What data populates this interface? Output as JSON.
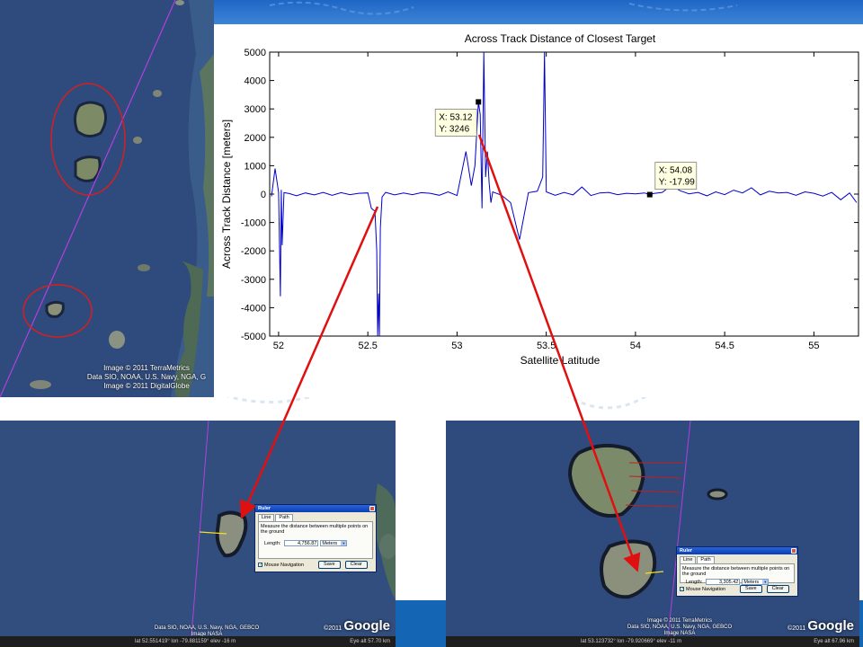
{
  "chart_data": {
    "type": "line",
    "title": "Across Track Distance of Closest Target",
    "xlabel": "Satellite Latitude",
    "ylabel": "Across Track Distance [meters]",
    "xlim": [
      51.95,
      55.25
    ],
    "ylim": [
      -5000,
      5000
    ],
    "x_ticks": [
      52,
      52.5,
      53,
      53.5,
      54,
      54.5,
      55
    ],
    "x_tick_labels": [
      "52",
      "52.5",
      "53",
      "53.5",
      "54",
      "54.5",
      "55"
    ],
    "y_ticks": [
      -5000,
      -4000,
      -3000,
      -2000,
      -1000,
      0,
      1000,
      2000,
      3000,
      4000,
      5000
    ],
    "y_tick_labels": [
      "-5000",
      "-4000",
      "-3000",
      "-2000",
      "-1000",
      "0",
      "1000",
      "2000",
      "3000",
      "4000",
      "5000"
    ],
    "grid": false,
    "line_color": "#0000cc",
    "series": [
      {
        "x": [
          51.96,
          51.98,
          52.0,
          52.01,
          52.015,
          52.02,
          52.03,
          52.06,
          52.1,
          52.15,
          52.2,
          52.25,
          52.3,
          52.35,
          52.4,
          52.45,
          52.5,
          52.52,
          52.54,
          52.55,
          52.555,
          52.56,
          52.565,
          52.57,
          52.58,
          52.6,
          52.65,
          52.7,
          52.75,
          52.8,
          52.85,
          52.9,
          52.95,
          53.0,
          53.05,
          53.08,
          53.1,
          53.12,
          53.13,
          53.14,
          53.15,
          53.16,
          53.17,
          53.18,
          53.19,
          53.2,
          53.25,
          53.3,
          53.35,
          53.4,
          53.45,
          53.48,
          53.49,
          53.5,
          53.55,
          53.6,
          53.65,
          53.7,
          53.75,
          53.8,
          53.85,
          53.9,
          53.95,
          54.0,
          54.05,
          54.08,
          54.1,
          54.15,
          54.2,
          54.25,
          54.3,
          54.35,
          54.4,
          54.45,
          54.5,
          54.55,
          54.6,
          54.65,
          54.7,
          54.75,
          54.8,
          54.85,
          54.9,
          54.95,
          55.0,
          55.05,
          55.1,
          55.15,
          55.2,
          55.24
        ],
        "y": [
          -80,
          900,
          60,
          -3600,
          150,
          -1800,
          50,
          20,
          -60,
          40,
          -30,
          60,
          -40,
          50,
          -20,
          30,
          40,
          -500,
          -600,
          -2000,
          -5000,
          -3500,
          -5000,
          -1200,
          -100,
          60,
          -30,
          40,
          -20,
          50,
          30,
          -40,
          80,
          -50,
          1500,
          300,
          1000,
          3246,
          2800,
          -500,
          5000,
          600,
          1500,
          400,
          -300,
          80,
          -40,
          -300,
          -1600,
          50,
          100,
          600,
          5000,
          80,
          -40,
          60,
          -30,
          250,
          -50,
          40,
          60,
          -20,
          30,
          10,
          40,
          -17.99,
          20,
          60,
          300,
          120,
          10,
          60,
          -60,
          80,
          -20,
          140,
          40,
          220,
          -30,
          100,
          40,
          60,
          -40,
          80,
          30,
          -70,
          60,
          -200,
          40,
          -300
        ]
      }
    ],
    "annotations": [
      {
        "x": 53.12,
        "y": 3246,
        "label_x": "X: 53.12",
        "label_y": "Y: 3246"
      },
      {
        "x": 54.08,
        "y": -17.99,
        "label_x": "X: 54.08",
        "label_y": "Y: -17.99"
      }
    ]
  },
  "imagery": {
    "left_credits": [
      "Image © 2011 TerraMetrics",
      "Data SIO, NOAA, U.S. Navy, NGA, G",
      "Image © 2011 DigitalGlobe"
    ],
    "bl_credits": [
      "Data SIO, NOAA, U.S. Navy, NGA, GEBCO",
      "Image NASA"
    ],
    "br_credits": [
      "Image © 2011 TerraMetrics",
      "Data SIO, NOAA, U.S. Navy, NGA, GEBCO",
      "Image NASA"
    ],
    "google_logo": "Google",
    "google_prefix": "©2011",
    "bl_status_left": "lat  52.551419°  lon  -79.881159°  elev  -16 m",
    "bl_status_right": "Eye alt   57.70 km",
    "br_status_left": "lat  53.123732°  lon  -79.920669°  elev  -11 m",
    "br_status_right": "Eye alt   67.96 km"
  },
  "ruler_left": {
    "title": "Ruler",
    "tab_line": "Line",
    "tab_path": "Path",
    "instruction": "Measure the distance between multiple points on the ground",
    "length_label": "Length:",
    "length_value": "4,756.87",
    "units": "Meters",
    "mouse_nav": "Mouse Navigation",
    "save": "Save",
    "clear": "Clear"
  },
  "ruler_right": {
    "title": "Ruler",
    "tab_line": "Line",
    "tab_path": "Path",
    "instruction": "Measure the distance between multiple points on the ground",
    "length_label": "Length:",
    "length_value": "3,305.42",
    "units": "Meters",
    "mouse_nav": "Mouse Navigation",
    "save": "Save",
    "clear": "Clear"
  },
  "colors": {
    "arrow": "#e01010",
    "circle": "#d42020",
    "track": "#b040e0",
    "ocean": "#2f4a7c"
  }
}
